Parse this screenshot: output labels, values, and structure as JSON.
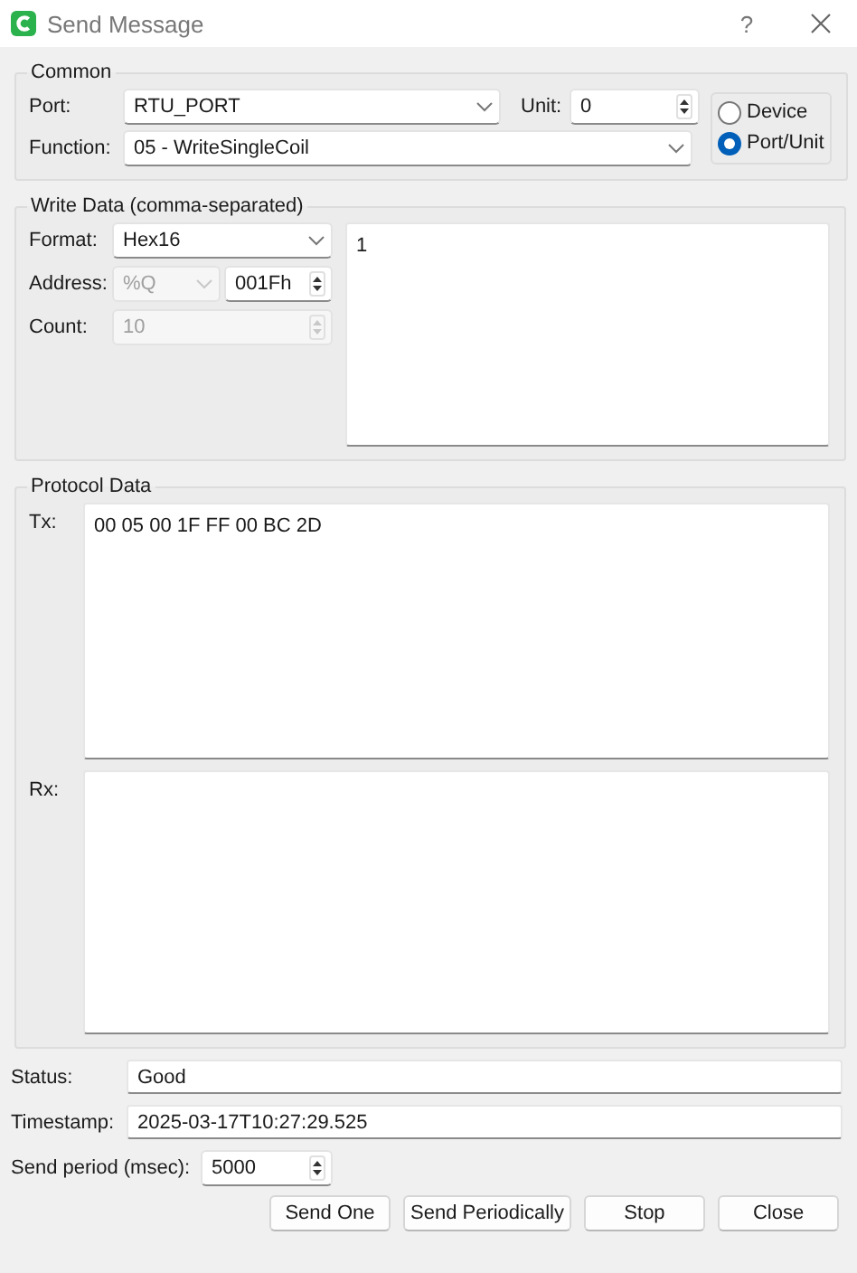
{
  "window": {
    "title": "Send Message",
    "help": "?"
  },
  "common": {
    "title": "Common",
    "port": {
      "label": "Port:",
      "value": "RTU_PORT"
    },
    "unit": {
      "label": "Unit:",
      "value": "0"
    },
    "function": {
      "label": "Function:",
      "value": "05 - WriteSingleCoil"
    },
    "address_mode": [
      {
        "label": "Device",
        "selected": false
      },
      {
        "label": "Port/Unit",
        "selected": true
      }
    ]
  },
  "write_data": {
    "title": "Write Data (comma-separated)",
    "format": {
      "label": "Format:",
      "value": "Hex16"
    },
    "address": {
      "label": "Address:",
      "type": "%Q",
      "type_disabled": true,
      "value": "001Fh"
    },
    "count": {
      "label": "Count:",
      "value": "10",
      "disabled": true
    },
    "values": "1"
  },
  "protocol": {
    "title": "Protocol Data",
    "tx": {
      "label": "Tx:",
      "value": "00 05 00 1F FF 00 BC 2D"
    },
    "rx": {
      "label": "Rx:"
    }
  },
  "status": {
    "label": "Status:",
    "value": "Good"
  },
  "timestamp": {
    "label": "Timestamp:",
    "value": "2025-03-17T10:27:29.525"
  },
  "send_period": {
    "label": "Send period (msec):",
    "value": "5000"
  },
  "buttons": [
    {
      "label": "Send One"
    },
    {
      "label": "Send Periodically"
    },
    {
      "label": "Stop"
    },
    {
      "label": "Close"
    }
  ]
}
